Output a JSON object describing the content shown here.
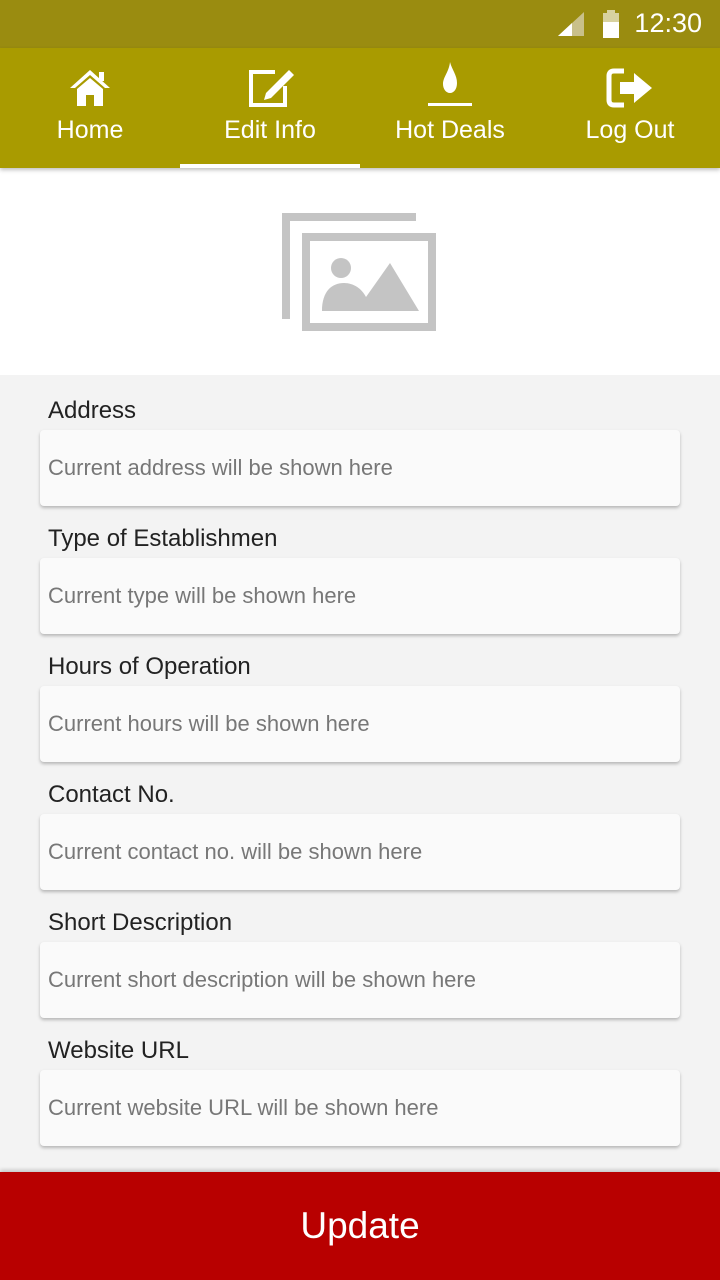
{
  "status_bar": {
    "time": "12:30"
  },
  "nav": {
    "tabs": [
      {
        "label": "Home",
        "icon": "home-icon"
      },
      {
        "label": "Edit Info",
        "icon": "edit-icon",
        "active": true
      },
      {
        "label": "Hot Deals",
        "icon": "flame-icon"
      },
      {
        "label": "Log Out",
        "icon": "logout-icon"
      }
    ]
  },
  "hero": {
    "icon": "image-placeholder-icon"
  },
  "form": {
    "fields": [
      {
        "label": "Address",
        "placeholder": "Current address will be shown here"
      },
      {
        "label": "Type of Establishmen",
        "placeholder": "Current type will be shown here"
      },
      {
        "label": "Hours of Operation",
        "placeholder": "Current hours will be shown here"
      },
      {
        "label": "Contact No.",
        "placeholder": "Current contact no. will be shown here"
      },
      {
        "label": "Short Description",
        "placeholder": "Current short description will be shown here"
      },
      {
        "label": "Website URL",
        "placeholder": "Current website URL will be shown here"
      }
    ]
  },
  "actions": {
    "update_label": "Update"
  },
  "colors": {
    "status_bar": "#9a8c10",
    "nav_bar": "#a99b00",
    "update_button": "#b80000",
    "placeholder_icon": "#c4c4c4"
  }
}
